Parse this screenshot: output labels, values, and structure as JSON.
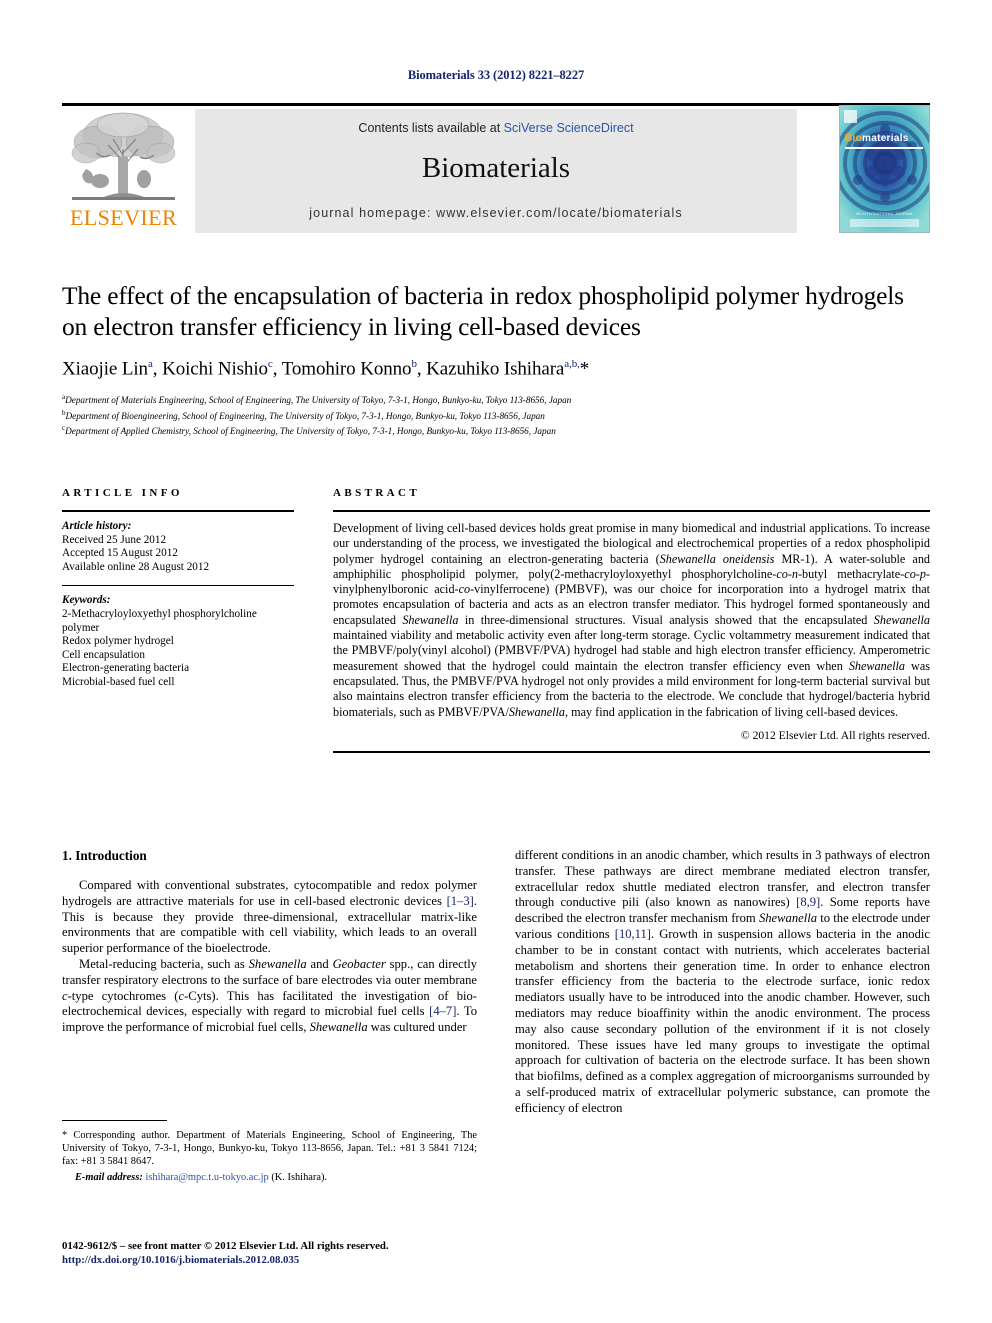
{
  "running_head": "Biomaterials 33 (2012) 8221–8227",
  "masthead": {
    "contents_prefix": "Contents lists available at ",
    "sciencedirect": "SciVerse ScienceDirect",
    "journal_name": "Biomaterials",
    "homepage": "journal homepage: www.elsevier.com/locate/biomaterials",
    "publisher": "ELSEVIER",
    "cover": {
      "title_part1": "Bio",
      "title_part2": "materials",
      "footer_text": "AN INTERNATIONAL JOURNAL"
    }
  },
  "article": {
    "title": "The effect of the encapsulation of bacteria in redox phospholipid polymer hydrogels on electron transfer efficiency in living cell-based devices",
    "authors": [
      {
        "name": "Xiaojie Lin",
        "sup": "a"
      },
      {
        "name": "Koichi Nishio",
        "sup": "c"
      },
      {
        "name": "Tomohiro Konno",
        "sup": "b"
      },
      {
        "name": "Kazuhiko Ishihara",
        "sup": "a,b,"
      }
    ],
    "affiliations": [
      {
        "marker": "a",
        "text": "Department of Materials Engineering, School of Engineering, The University of Tokyo, 7-3-1, Hongo, Bunkyo-ku, Tokyo 113-8656, Japan"
      },
      {
        "marker": "b",
        "text": "Department of Bioengineering, School of Engineering, The University of Tokyo, 7-3-1, Hongo, Bunkyo-ku, Tokyo 113-8656, Japan"
      },
      {
        "marker": "c",
        "text": "Department of Applied Chemistry, School of Engineering, The University of Tokyo, 7-3-1, Hongo, Bunkyo-ku, Tokyo 113-8656, Japan"
      }
    ]
  },
  "article_info": {
    "heading": "ARTICLE INFO",
    "history_label": "Article history:",
    "history": [
      "Received 25 June 2012",
      "Accepted 15 August 2012",
      "Available online 28 August 2012"
    ],
    "keywords_label": "Keywords:",
    "keywords": [
      "2-Methacryloyloxyethyl phosphorylcholine polymer",
      "Redox polymer hydrogel",
      "Cell encapsulation",
      "Electron-generating bacteria",
      "Microbial-based fuel cell"
    ]
  },
  "abstract": {
    "heading": "ABSTRACT",
    "copyright": "© 2012 Elsevier Ltd. All rights reserved."
  },
  "introduction": {
    "heading": "1. Introduction"
  },
  "footnote": {
    "corresponding": "* Corresponding author. Department of Materials Engineering, School of Engineering, The University of Tokyo, 7-3-1, Hongo, Bunkyo-ku, Tokyo 113-8656, Japan. Tel.: +81 3 5841 7124; fax: +81 3 5841 8647.",
    "email_label": "E-mail address:",
    "email": "ishihara@mpc.t.u-tokyo.ac.jp",
    "email_owner": "(K. Ishihara)."
  },
  "imprint": {
    "line1": "0142-9612/$ – see front matter © 2012 Elsevier Ltd. All rights reserved.",
    "doi": "http://dx.doi.org/10.1016/j.biomaterials.2012.08.035"
  }
}
